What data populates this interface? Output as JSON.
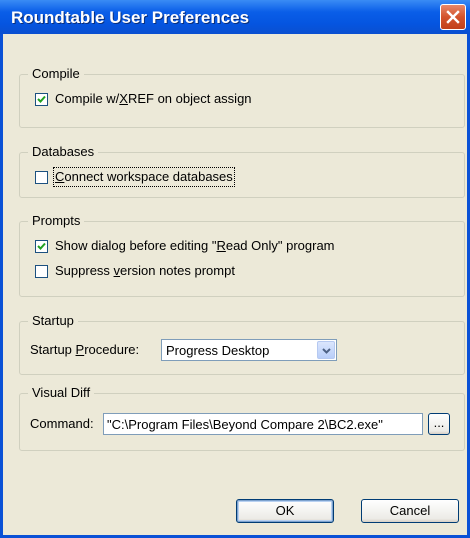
{
  "window": {
    "title": "Roundtable User Preferences"
  },
  "groups": {
    "compile": {
      "label": "Compile",
      "compile_xref": {
        "pre": "Compile w/",
        "acc": "X",
        "post": "REF on object assign",
        "checked": true
      }
    },
    "databases": {
      "label": "Databases",
      "connect_workspace": {
        "pre": "",
        "acc": "C",
        "post": "onnect workspace databases",
        "checked": false
      }
    },
    "prompts": {
      "label": "Prompts",
      "show_dialog": {
        "pre": "Show dialog before editing \"",
        "acc": "R",
        "post": "ead Only\" program",
        "checked": true
      },
      "suppress_notes": {
        "pre": "Suppress ",
        "acc": "v",
        "post": "ersion notes prompt",
        "checked": false
      }
    },
    "startup": {
      "label": "Startup",
      "procedure_label": {
        "pre": "Startup ",
        "acc": "P",
        "post": "rocedure:"
      },
      "procedure_value": "Progress Desktop"
    },
    "visual_diff": {
      "label": "Visual Diff",
      "command_label": "Command:",
      "command_value": "\"C:\\Program Files\\Beyond Compare 2\\BC2.exe\"",
      "browse_label": "..."
    }
  },
  "buttons": {
    "ok": "OK",
    "cancel": "Cancel"
  },
  "colors": {
    "titlebar": "#0a5ee8",
    "client": "#ece9d8",
    "close": "#d3532c",
    "check": "#21a121"
  }
}
